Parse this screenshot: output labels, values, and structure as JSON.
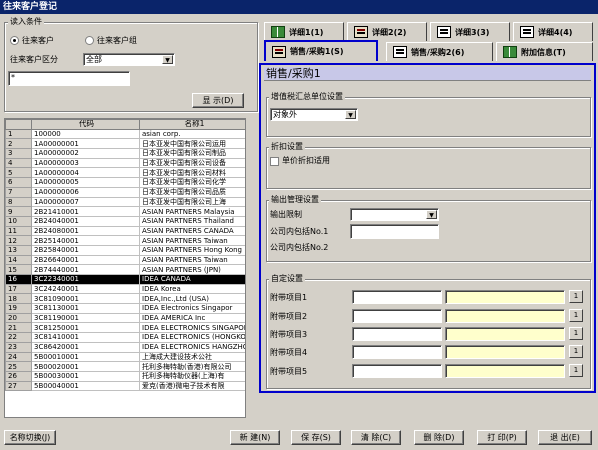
{
  "window": {
    "title": "往来客户登记"
  },
  "conditions": {
    "group_label": "读入条件",
    "radio_customer": "往来客户",
    "radio_customer_group": "往来客户组",
    "category_label": "往来客户区分",
    "category_value": "全部",
    "search_value": "*",
    "display_button": "显 示(D)"
  },
  "grid": {
    "headers": [
      "",
      "代码",
      "名称1"
    ],
    "rows": [
      {
        "no": "1",
        "code": "100000",
        "name": "asian corp."
      },
      {
        "no": "2",
        "code": "1A00000001",
        "name": "日本亚发中国有限公司运用"
      },
      {
        "no": "3",
        "code": "1A00000002",
        "name": "日本亚发中国有限公司制品"
      },
      {
        "no": "4",
        "code": "1A00000003",
        "name": "日本亚发中国有限公司设备"
      },
      {
        "no": "5",
        "code": "1A00000004",
        "name": "日本亚发中国有限公司材料"
      },
      {
        "no": "6",
        "code": "1A00000005",
        "name": "日本亚发中国有限公司化学"
      },
      {
        "no": "7",
        "code": "1A00000006",
        "name": "日本亚发中国有限公司品质"
      },
      {
        "no": "8",
        "code": "1A00000007",
        "name": "日本亚发中国有限公司上海"
      },
      {
        "no": "9",
        "code": "2B21410001",
        "name": "ASIAN PARTNERS Malaysia"
      },
      {
        "no": "10",
        "code": "2B24040001",
        "name": "ASIAN PARTNERS Thailand"
      },
      {
        "no": "11",
        "code": "2B24080001",
        "name": "ASIAN PARTNERS CANADA"
      },
      {
        "no": "12",
        "code": "2B25140001",
        "name": "ASIAN PARTNERS Taiwan"
      },
      {
        "no": "13",
        "code": "2B25840001",
        "name": "ASIAN PARTNERS Hong Kong"
      },
      {
        "no": "14",
        "code": "2B26640001",
        "name": "ASIAN PARTNERS Taiwan"
      },
      {
        "no": "15",
        "code": "2B74440001",
        "name": "ASIAN PARTNERS (JPN)"
      },
      {
        "no": "16",
        "code": "3C22340001",
        "name": "IDEA CANADA"
      },
      {
        "no": "17",
        "code": "3C24240001",
        "name": "IDEA Korea"
      },
      {
        "no": "18",
        "code": "3C81090001",
        "name": "IDEA,Inc.,Ltd (USA)"
      },
      {
        "no": "19",
        "code": "3C81130001",
        "name": "IDEA Electronics Singapor"
      },
      {
        "no": "20",
        "code": "3C81190001",
        "name": "IDEA AMERICA Inc"
      },
      {
        "no": "21",
        "code": "3C81250001",
        "name": "IDEA ELECTRONICS SINGAPOR"
      },
      {
        "no": "22",
        "code": "3C81410001",
        "name": "IDEA ELECTRONICS (HONGKON"
      },
      {
        "no": "23",
        "code": "3C86420001",
        "name": "IDEA ELECTRONICS HANGZHOU"
      },
      {
        "no": "24",
        "code": "5B00010001",
        "name": "上海成大建设技术公社"
      },
      {
        "no": "25",
        "code": "5B00020001",
        "name": "托利多梅特勒(香港)有限公司"
      },
      {
        "no": "26",
        "code": "5B00030001",
        "name": "托利多梅特勒仪器(上海)有"
      },
      {
        "no": "27",
        "code": "5B00040001",
        "name": "爱克(香港)微电子技术有限"
      }
    ],
    "selected_row": "16"
  },
  "tabs": {
    "detail1": "详细1(1)",
    "detail2": "详细2(2)",
    "detail3": "详细3(3)",
    "detail4": "详细4(4)",
    "sales1": "销售/采购1(S)",
    "sales2": "销售/采购2(6)",
    "extra": "附加信息(T)"
  },
  "panel": {
    "title": "销售/采购1",
    "vat_group": "增值税汇总单位设置",
    "vat_value": "对象外",
    "discount_group": "折扣设置",
    "discount_checkbox": "单价折扣适用",
    "output_group": "输出管理设置",
    "output_limit": "输出限制",
    "company_no1": "公司内包括No.1",
    "company_no2": "公司内包括No.2",
    "custom_group": "自定设置",
    "custom1": "附带项目1",
    "custom2": "附带项目2",
    "custom3": "附带项目3",
    "custom4": "附带项目4",
    "custom5": "附带项目5",
    "small_btn": "1"
  },
  "bottom": {
    "name_switch": "名称切换(J)",
    "new": "新 建(N)",
    "save": "保 存(S)",
    "clear": "清 除(C)",
    "delete": "删 除(D)",
    "print": "打 印(P)",
    "exit": "退 出(E)"
  }
}
